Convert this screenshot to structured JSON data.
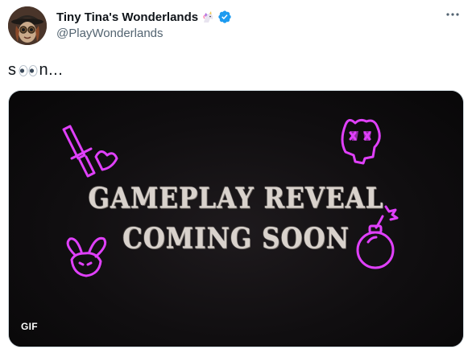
{
  "author": {
    "display_name": "Tiny Tina's Wonderlands",
    "name_emoji": "unicorn-icon",
    "handle": "@PlayWonderlands",
    "verified": true
  },
  "tweet": {
    "text_start": "s",
    "text_eyes": "👀",
    "text_end": "n..."
  },
  "media": {
    "type": "gif",
    "badge": "GIF",
    "headline_line1": "GAMEPLAY REVEAL",
    "headline_line2": "COMING SOON",
    "doodle_color": "#e040fb"
  },
  "colors": {
    "text_primary": "#0f1419",
    "text_secondary": "#536471",
    "verified_blue": "#1d9bf0"
  }
}
